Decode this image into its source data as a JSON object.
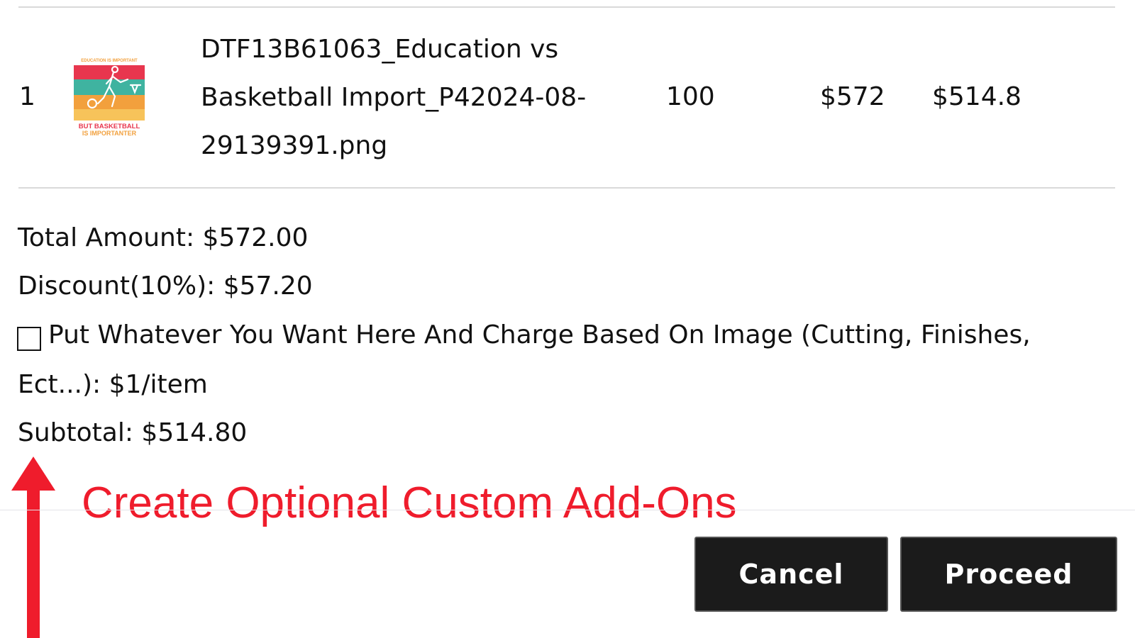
{
  "order_table": {
    "rows": [
      {
        "index": "1",
        "thumbnail": {
          "icon": "basketball-design-thumbnail",
          "top_text": "EDUCATION IS IMPORTANT",
          "bottom_text_1": "BUT BASKETBALL",
          "bottom_text_2": "IS IMPORTANTER",
          "stripe_colors": [
            "#e8364e",
            "#3fb3a0",
            "#f2a03d",
            "#f7c35a"
          ]
        },
        "file_name_lines": [
          "DTF13B61063_Education vs",
          "Basketball Import_P42024-08-",
          "29139391.png"
        ],
        "quantity": "100",
        "price": "$572",
        "total": "$514.8"
      }
    ]
  },
  "summary": {
    "total_amount": "Total Amount: $572.00",
    "discount": "Discount(10%): $57.20",
    "addon_line_1": "Put Whatever You Want Here And Charge Based On Image (Cutting, Finishes,",
    "addon_line_2": "Ect...): $1/item",
    "addon_checked": false,
    "subtotal": "Subtotal: $514.80"
  },
  "annotation": {
    "text": "Create Optional Custom Add-Ons",
    "color": "#ef1c2c"
  },
  "actions": {
    "cancel_label": "Cancel",
    "proceed_label": "Proceed"
  }
}
